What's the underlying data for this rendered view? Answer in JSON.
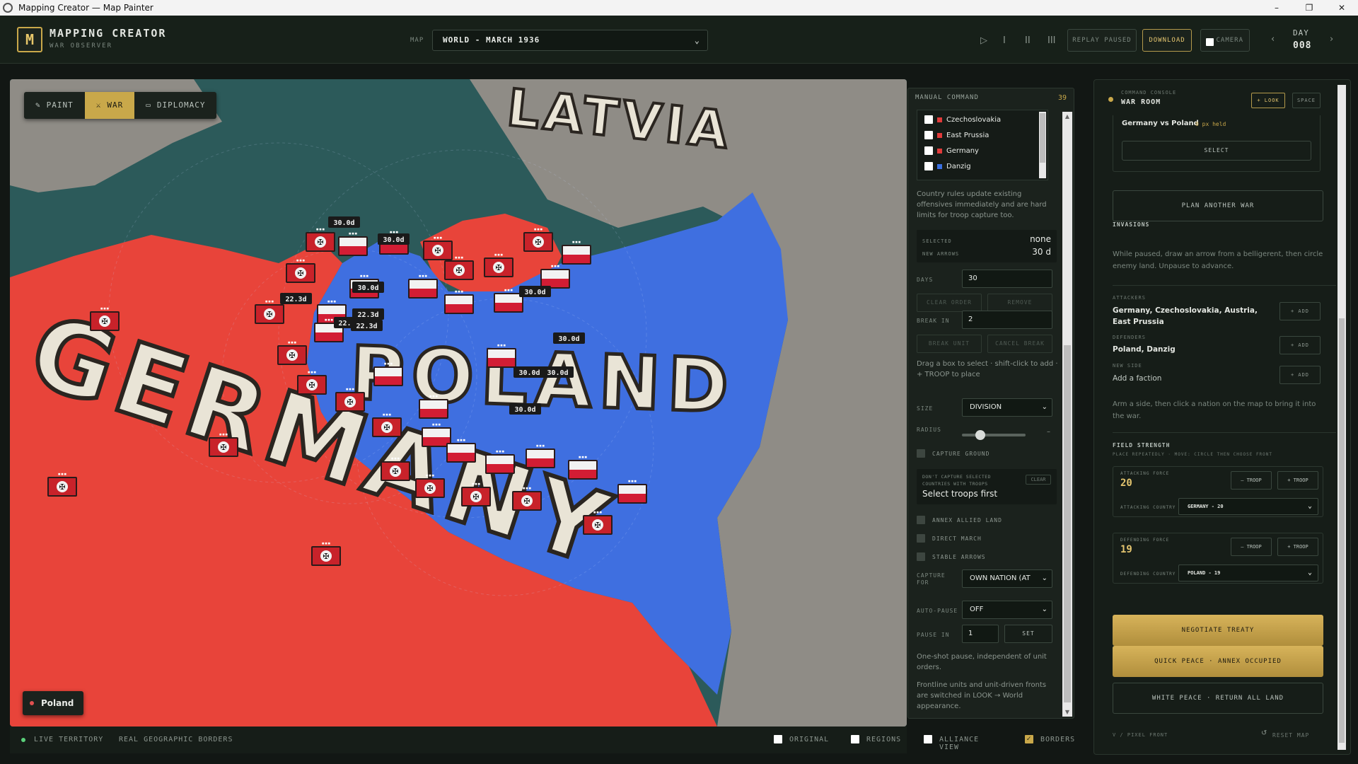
{
  "window": {
    "title": "Mapping Creator — Map Painter",
    "controls": [
      "–",
      "❐",
      "✕"
    ]
  },
  "header": {
    "logo": "M",
    "app_name": "MAPPING CREATOR",
    "app_sub": "WAR OBSERVER",
    "map_label": "MAP",
    "map_value": "WORLD - MARCH 1936",
    "replay_status": "REPLAY PAUSED",
    "download": "DOWNLOAD",
    "camera": "CAMERA",
    "day_label": "DAY",
    "day_value": "008",
    "icons": [
      "play-icon",
      "step-icon",
      "pause-icon",
      "stop-icon",
      "chevron-left-icon",
      "chevron-right-icon"
    ]
  },
  "map": {
    "modes": [
      {
        "label": "PAINT",
        "icon": "brush-icon",
        "active": false
      },
      {
        "label": "WAR",
        "icon": "swords-icon",
        "active": true
      },
      {
        "label": "DIPLOMACY",
        "icon": "folder-icon",
        "active": false
      }
    ],
    "labels": {
      "latvia": "LATVIA",
      "poland": "POLAND",
      "germany": "GERMANY"
    },
    "timers": [
      "30.0d",
      "30.0d",
      "30.0d",
      "22.3d",
      "22.3d",
      "22.3d",
      "22.",
      "30.0d",
      "30.0d",
      "30.0d",
      "30.0d",
      "30.0d"
    ],
    "selected_chip": "Poland",
    "colors": {
      "germany": "#e8443a",
      "poland": "#3f6fe0",
      "sea": "#2c5a5a",
      "neutral": "#8f8c86"
    }
  },
  "status_bar": {
    "live": "LIVE TERRITORY",
    "borders_mode": "REAL GEOGRAPHIC BORDERS",
    "toggles": [
      {
        "label": "ORIGINAL",
        "checked": false
      },
      {
        "label": "REGIONS",
        "checked": false
      },
      {
        "label": "ALLIANCE VIEW",
        "checked": false
      },
      {
        "label": "BORDERS",
        "checked": true
      }
    ]
  },
  "manual": {
    "title": "MANUAL COMMAND",
    "count": "39",
    "countries": [
      {
        "name": "Czechoslovakia",
        "color": "#e03a3a"
      },
      {
        "name": "East Prussia",
        "color": "#e03a3a"
      },
      {
        "name": "Germany",
        "color": "#e03a3a"
      },
      {
        "name": "Danzig",
        "color": "#3a6fe0"
      }
    ],
    "rules_note": "Country rules update existing offensives immediately and are hard limits for troop capture too.",
    "selected_label": "SELECTED",
    "selected_value": "none",
    "new_arrows_label": "NEW ARROWS",
    "new_arrows_value": "30 d",
    "days_label": "DAYS",
    "days_value": "30",
    "clear_order": "CLEAR ORDER",
    "remove": "REMOVE",
    "break_in_label": "BREAK IN",
    "break_in_value": "2",
    "break_unit": "BREAK UNIT",
    "cancel_break": "CANCEL BREAK",
    "drag_note": "Drag a box to select · shift-click to add · + TROOP to place",
    "size_label": "SIZE",
    "size_value": "DIVISION",
    "radius_label": "RADIUS",
    "radius_level": 0.15,
    "radius_dash": "–",
    "capture_ground": "CAPTURE GROUND",
    "capture_note": "DON'T CAPTURE SELECTED COUNTRIES WITH TROOPS",
    "clear": "CLEAR",
    "select_first": "Select troops first",
    "annex_allied": "ANNEX ALLIED LAND",
    "direct_march": "DIRECT MARCH",
    "stable_arrows": "STABLE ARROWS",
    "capture_for_label": "CAPTURE FOR",
    "capture_for_value": "OWN NATION (AT",
    "auto_pause_label": "AUTO-PAUSE",
    "auto_pause_value": "OFF",
    "pause_in_label": "PAUSE IN",
    "pause_in_value": "1",
    "set": "SET",
    "oneshot_note": "One-shot pause, independent of unit orders.",
    "frontline_note": "Frontline units and unit-driven fronts are switched in LOOK → World appearance."
  },
  "warroom": {
    "console_label": "COMMAND CONSOLE",
    "title": "WAR ROOM",
    "look": "+ LOOK",
    "space": "SPACE",
    "matchup": "Germany vs Poland",
    "held": "0 px held",
    "select": "SELECT",
    "plan_war": "PLAN ANOTHER WAR",
    "invasions": "INVASIONS",
    "invasions_note": "While paused, draw an arrow from a belligerent, then circle enemy land. Unpause to advance.",
    "attackers_label": "ATTACKERS",
    "attackers": "Germany, Czechoslovakia, Austria, East Prussia",
    "defenders_label": "DEFENDERS",
    "defenders": "Poland, Danzig",
    "new_side_label": "NEW SIDE",
    "new_side": "Add a faction",
    "add": "+ ADD",
    "arm_note": "Arm a side, then click a nation on the map to bring it into the war.",
    "field_strength": "FIELD STRENGTH",
    "field_note": "PLACE REPEATEDLY · MOVE: CIRCLE THEN CHOOSE FRONT",
    "attacking_force_label": "ATTACKING FORCE",
    "attacking_force": "20",
    "attacking_country_label": "ATTACKING COUNTRY",
    "attacking_country": "GERMANY - 20",
    "defending_force_label": "DEFENDING FORCE",
    "defending_force": "19",
    "defending_country_label": "DEFENDING COUNTRY",
    "defending_country": "POLAND - 19",
    "minus_troop": "– TROOP",
    "plus_troop": "+ TROOP",
    "negotiate": "NEGOTIATE TREATY",
    "quick_peace": "QUICK PEACE · ANNEX OCCUPIED",
    "white_peace": "WHITE PEACE · RETURN ALL LAND",
    "pixel_front": "V / PIXEL FRONT",
    "reset_map": "RESET MAP"
  }
}
